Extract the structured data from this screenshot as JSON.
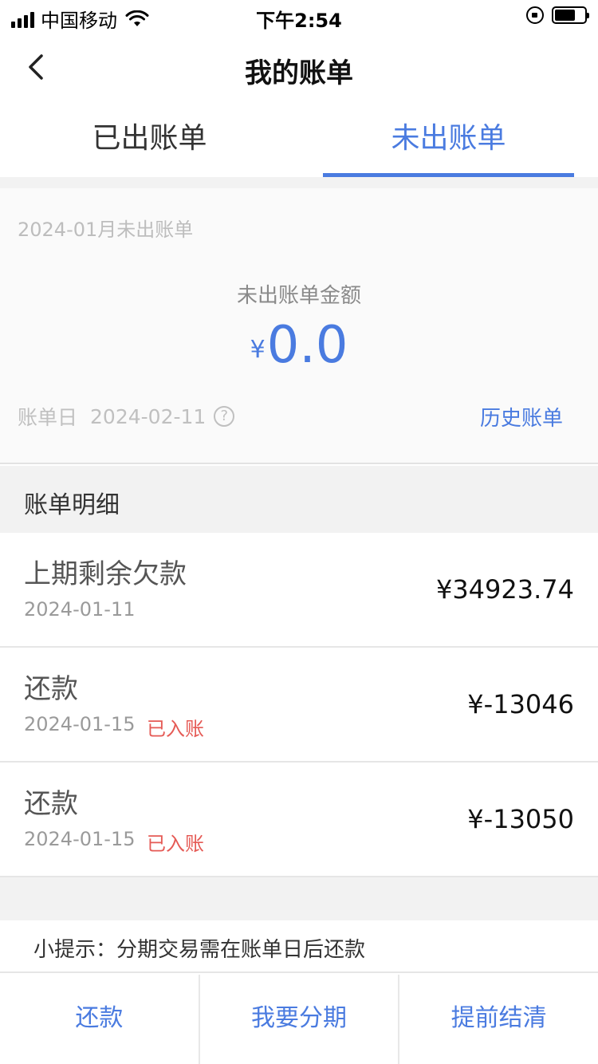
{
  "status_bar": {
    "carrier": "中国移动",
    "time": "下午2:54"
  },
  "navbar": {
    "title": "我的账单"
  },
  "tabs": [
    {
      "label": "已出账单",
      "active": false
    },
    {
      "label": "未出账单",
      "active": true
    }
  ],
  "summary": {
    "month_label": "2024-01月未出账单",
    "amount_label": "未出账单金额",
    "currency": "¥",
    "amount": "0.0",
    "bill_day_label": "账单日",
    "bill_day": "2024-02-11",
    "history_link": "历史账单"
  },
  "details": {
    "header": "账单明细",
    "rows": [
      {
        "title": "上期剩余欠款",
        "date": "2024-01-11",
        "status": "",
        "amount": "¥34923.74"
      },
      {
        "title": "还款",
        "date": "2024-01-15",
        "status": "已入账",
        "amount": "¥-13046"
      },
      {
        "title": "还款",
        "date": "2024-01-15",
        "status": "已入账",
        "amount": "¥-13050"
      }
    ]
  },
  "tip": "小提示：分期交易需在账单日后还款",
  "actions": {
    "repay": "还款",
    "installment": "我要分期",
    "early_settle": "提前结清"
  },
  "colors": {
    "accent": "#4a7be0",
    "status_red": "#e55a55"
  }
}
